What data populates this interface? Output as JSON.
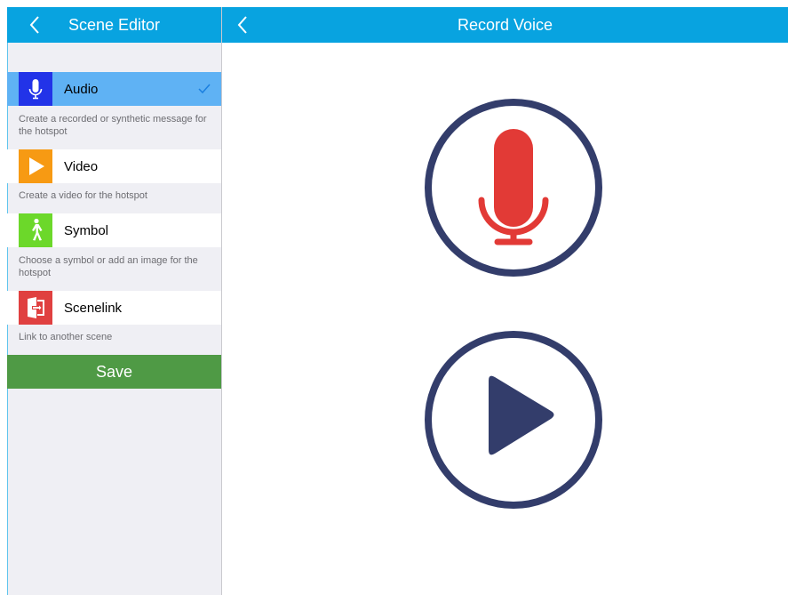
{
  "left_header": {
    "title": "Scene Editor",
    "back_icon": "chevron-left-icon"
  },
  "right_header": {
    "title": "Record Voice",
    "back_icon": "chevron-left-icon"
  },
  "menu": [
    {
      "label": "Audio",
      "icon": "microphone-icon",
      "color": "#2233e8",
      "selected": true,
      "description": "Create a  recorded or synthetic message for the hotspot"
    },
    {
      "label": "Video",
      "icon": "play-icon",
      "color": "#f79a13",
      "selected": false,
      "description": "Create a video for the hotspot"
    },
    {
      "label": "Symbol",
      "icon": "walking-person-icon",
      "color": "#6cd82a",
      "selected": false,
      "description": "Choose a symbol or add an image for the hotspot"
    },
    {
      "label": "Scenelink",
      "icon": "door-icon",
      "color": "#e04040",
      "selected": false,
      "description": "Link to another scene"
    }
  ],
  "save_button": {
    "label": "Save"
  },
  "colors": {
    "header_blue": "#08a3e0",
    "selected_row": "#5fb2f4",
    "save_green": "#4f9a45",
    "circle_navy": "#333d6b",
    "mic_red": "#e23a36"
  },
  "main": {
    "record_icon": "microphone-icon",
    "play_icon": "play-icon"
  }
}
